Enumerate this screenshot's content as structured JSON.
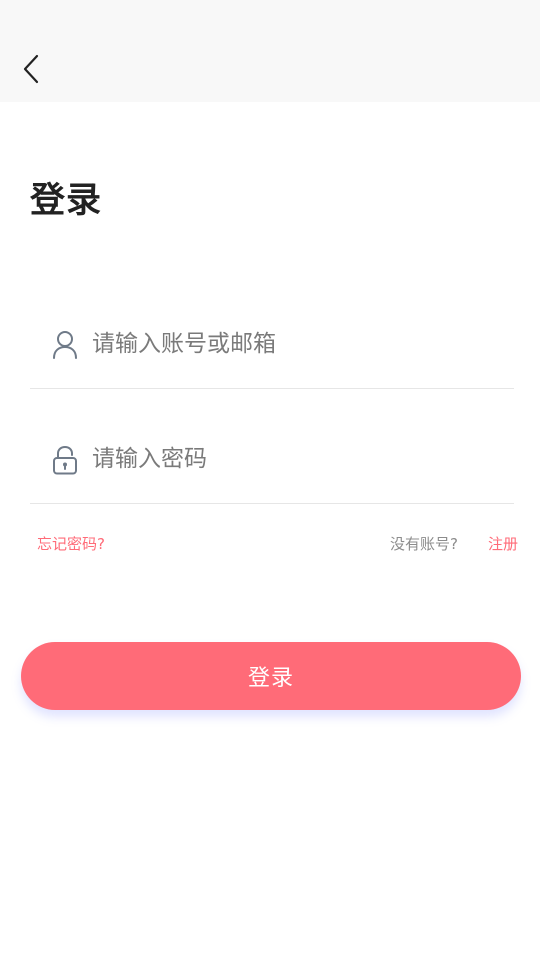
{
  "header": {
    "back_icon": "chevron-left-icon"
  },
  "page_title": "登录",
  "form": {
    "username": {
      "icon": "user-icon",
      "placeholder": "请输入账号或邮箱",
      "value": ""
    },
    "password": {
      "icon": "lock-icon",
      "placeholder": "请输入密码",
      "value": ""
    },
    "forgot_password_label": "忘记密码?",
    "no_account_label": "没有账号?",
    "register_label": "注册",
    "login_button_label": "登录"
  },
  "colors": {
    "accent": "#ff6b78",
    "header_background": "#f8f8f8",
    "title_text": "#222222",
    "placeholder_text": "#7a7a7a",
    "secondary_text": "#8c8c8c",
    "divider": "#e6e6e6"
  }
}
